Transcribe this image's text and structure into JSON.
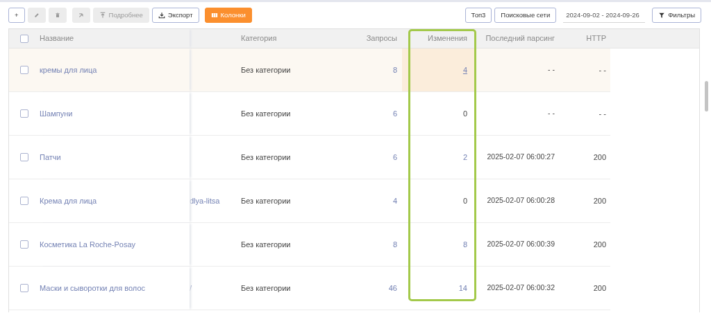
{
  "toolbar": {
    "left": [
      {
        "label": "+",
        "kind": "outline",
        "disabled": false
      },
      {
        "kind": "plain",
        "disabled": true
      },
      {
        "kind": "plain",
        "disabled": true
      },
      {
        "kind": "plain",
        "disabled": true
      },
      {
        "label": "Подробнее",
        "kind": "plain",
        "disabled": true
      },
      {
        "label": "Экспорт",
        "kind": "outline",
        "disabled": false
      },
      {
        "label": "Колонки",
        "kind": "accent",
        "disabled": false
      }
    ],
    "right": [
      {
        "label": "Топ3",
        "kind": "outline"
      },
      {
        "label": "Поисковые сети",
        "kind": "outline"
      },
      {
        "value": "2024-09-02 - 2024-09-26",
        "kind": "date"
      },
      {
        "label": "Фильтры",
        "kind": "outline"
      }
    ]
  },
  "table": {
    "all_checked": false,
    "columns": [
      {
        "label": "Название"
      },
      {
        "label": "Категория"
      },
      {
        "label": "Запросы"
      },
      {
        "label": "Изменения",
        "outlined": true
      },
      {
        "label": "Последний парсинг"
      },
      {
        "label": "HTTP"
      }
    ],
    "rows": [
      {
        "checked": false,
        "highlighted": true,
        "name": "кремы для лица",
        "category": "Без категории",
        "requests": "8",
        "changes": "4",
        "changes_link": true,
        "changes_hovered": true,
        "last_parsing": "- -",
        "http": "- -"
      },
      {
        "checked": false,
        "highlighted": false,
        "name": "Шампуни",
        "category": "Без категории",
        "requests": "6",
        "changes": "0",
        "changes_link": false,
        "changes_hovered": false,
        "last_parsing": "- -",
        "http": "- -"
      },
      {
        "checked": false,
        "highlighted": false,
        "name": "Патчи",
        "category": "Без категории",
        "requests": "6",
        "changes": "2",
        "changes_link": true,
        "changes_hovered": false,
        "last_parsing": "2025-02-07 06:00:27",
        "http": "200"
      },
      {
        "checked": false,
        "highlighted": false,
        "name": "Крема для лица",
        "column_2": "dlya-litsa",
        "category": "Без категории",
        "requests": "4",
        "changes": "0",
        "changes_link": false,
        "changes_hovered": false,
        "last_parsing": "2025-02-07 06:00:28",
        "http": "200"
      },
      {
        "checked": false,
        "highlighted": false,
        "name": "Косметика La Roche-Posay",
        "category": "Без категории",
        "requests": "8",
        "changes": "8",
        "changes_link": true,
        "changes_hovered": false,
        "last_parsing": "2025-02-07 06:00:39",
        "http": "200"
      },
      {
        "checked": false,
        "highlighted": false,
        "name": "Маски и сыворотки для волос",
        "column_2": "/",
        "category": "Без категории",
        "requests": "46",
        "changes": "14",
        "changes_link": true,
        "changes_hovered": false,
        "last_parsing": "2025-02-07 06:00:32",
        "http": "200"
      }
    ]
  }
}
